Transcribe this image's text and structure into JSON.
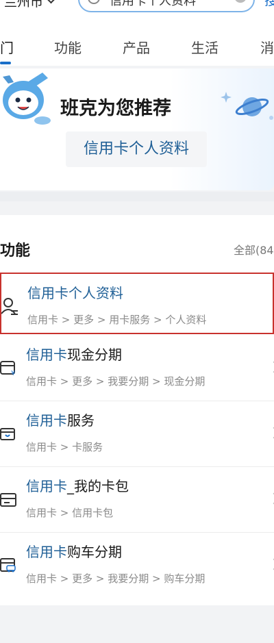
{
  "top": {
    "city": "兰州市",
    "search_value": "信用卡个人资料",
    "search_button": "搜"
  },
  "tabs": [
    "门",
    "功能",
    "产品",
    "生活",
    "消"
  ],
  "recommend": {
    "title": "班克为您推荐",
    "chip": "信用卡个人资料"
  },
  "functions": {
    "title": "功能",
    "all": "全部(84",
    "items": [
      {
        "name_blue": "信用卡个人资料",
        "name_rest": "",
        "path": "信用卡 > 更多 > 用卡服务 > 个人资料",
        "icon": "user-profile-icon"
      },
      {
        "name_blue": "信用卡",
        "name_rest": "现金分期",
        "path": "信用卡 > 更多 > 我要分期 > 现金分期",
        "icon": "cash-installment-icon"
      },
      {
        "name_blue": "信用卡",
        "name_rest": "服务",
        "path": "信用卡 > 卡服务",
        "icon": "card-service-icon"
      },
      {
        "name_blue": "信用卡",
        "name_rest": "_我的卡包",
        "path": "信用卡 > 信用卡包",
        "icon": "wallet-icon"
      },
      {
        "name_blue": "信用卡",
        "name_rest": "购车分期",
        "path": "信用卡 > 更多 > 我要分期 > 购车分期",
        "icon": "car-installment-icon"
      }
    ]
  },
  "colors": {
    "accent": "#1a6fc9",
    "highlight": "#c8312d",
    "link_blue": "#1f5f96"
  }
}
